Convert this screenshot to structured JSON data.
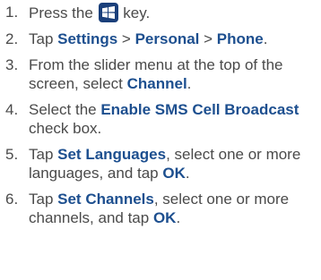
{
  "colors": {
    "text": "#4a4a4a",
    "emphasis": "#1d4f8f",
    "key_bg": "#1a3f7a"
  },
  "steps": [
    {
      "number": "1.",
      "parts": [
        {
          "t": "Press the ",
          "bold": false
        },
        {
          "icon": "windows-start-key-icon"
        },
        {
          "t": " key.",
          "bold": false
        }
      ]
    },
    {
      "number": "2.",
      "parts": [
        {
          "t": "Tap ",
          "bold": false
        },
        {
          "t": "Settings",
          "bold": true
        },
        {
          "t": " > ",
          "bold": false
        },
        {
          "t": "Personal",
          "bold": true
        },
        {
          "t": " > ",
          "bold": false
        },
        {
          "t": "Phone",
          "bold": true
        },
        {
          "t": ".",
          "bold": false
        }
      ]
    },
    {
      "number": "3.",
      "parts": [
        {
          "t": "From the slider menu at the top of the screen, select ",
          "bold": false
        },
        {
          "t": "Channel",
          "bold": true
        },
        {
          "t": ".",
          "bold": false
        }
      ]
    },
    {
      "number": "4.",
      "parts": [
        {
          "t": "Select the ",
          "bold": false
        },
        {
          "t": "Enable SMS Cell Broadcast",
          "bold": true
        },
        {
          "t": " check box.",
          "bold": false
        }
      ]
    },
    {
      "number": "5.",
      "parts": [
        {
          "t": "Tap ",
          "bold": false
        },
        {
          "t": "Set Languages",
          "bold": true
        },
        {
          "t": ", select one or more languages, and tap ",
          "bold": false
        },
        {
          "t": "OK",
          "bold": true
        },
        {
          "t": ".",
          "bold": false
        }
      ]
    },
    {
      "number": "6.",
      "parts": [
        {
          "t": "Tap ",
          "bold": false
        },
        {
          "t": "Set Channels",
          "bold": true
        },
        {
          "t": ", select one or more channels, and tap ",
          "bold": false
        },
        {
          "t": "OK",
          "bold": true
        },
        {
          "t": ".",
          "bold": false
        }
      ]
    }
  ]
}
